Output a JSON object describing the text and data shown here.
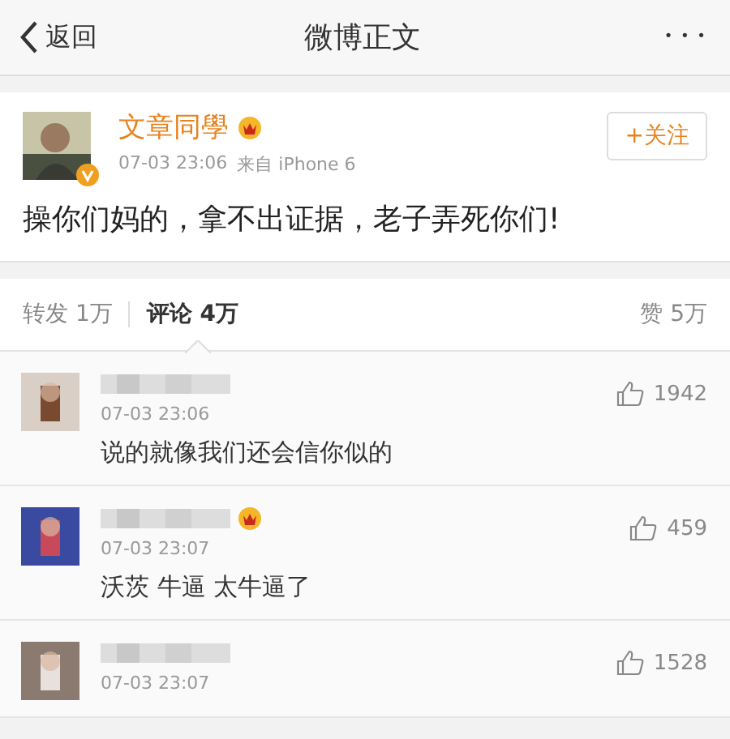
{
  "nav": {
    "back": "返回",
    "title": "微博正文",
    "more": "• • •"
  },
  "post": {
    "author": "文章同學",
    "vip": true,
    "verified": true,
    "time": "07-03 23:06",
    "source": "来自 iPhone 6",
    "follow": "+关注",
    "text": "操你们妈的，拿不出证据，老子弄死你们!"
  },
  "tabs": [
    {
      "label": "转发",
      "count": "1万",
      "selected": false
    },
    {
      "label": "评论",
      "count": "4万",
      "selected": true
    }
  ],
  "likes": {
    "label": "赞",
    "count": "5万"
  },
  "comments": [
    {
      "vip": false,
      "time": "07-03 23:06",
      "likes": "1942",
      "text": "说的就像我们还会信你似的"
    },
    {
      "vip": true,
      "time": "07-03 23:07",
      "likes": "459",
      "text": "沃茨 牛逼 太牛逼了"
    },
    {
      "vip": false,
      "time": "07-03 23:07",
      "likes": "1528"
    }
  ]
}
